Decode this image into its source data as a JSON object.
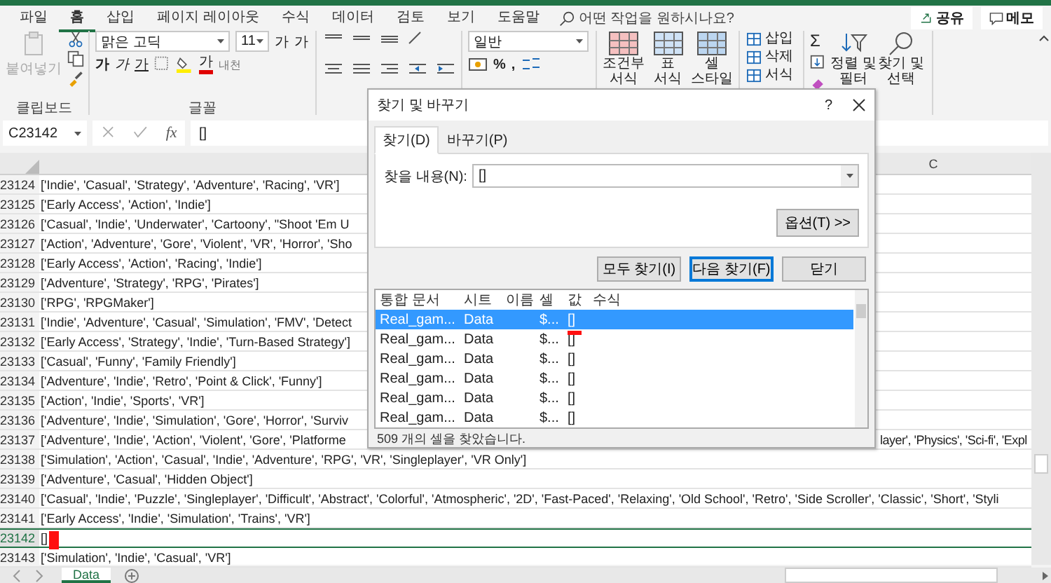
{
  "menu": {
    "tabs": [
      {
        "label": "파일",
        "selected": false
      },
      {
        "label": "홈",
        "selected": true
      },
      {
        "label": "삽입",
        "selected": false
      },
      {
        "label": "페이지 레이아웃",
        "selected": false
      },
      {
        "label": "수식",
        "selected": false
      },
      {
        "label": "데이터",
        "selected": false
      },
      {
        "label": "검토",
        "selected": false
      },
      {
        "label": "보기",
        "selected": false
      },
      {
        "label": "도움말",
        "selected": false
      }
    ],
    "search_placeholder": "어떤 작업을 원하시나요?",
    "share": "공유",
    "comments": "메모"
  },
  "ribbon": {
    "paste": {
      "label": "붙여넣기",
      "disabled": true
    },
    "clipboard_group": "클립보드",
    "font": {
      "name": "맑은 고딕",
      "size": "11",
      "grow": "가",
      "shrink": "가",
      "bold": "가",
      "italic": "가",
      "underline": "가",
      "font_color": "가",
      "phonetic": "내천",
      "group": "글꼴"
    },
    "number": {
      "format": "일반",
      "percent": "%",
      "comma": ","
    },
    "styles": [
      {
        "lines": [
          "조건부",
          "서식"
        ]
      },
      {
        "lines": [
          "표",
          "서식"
        ]
      },
      {
        "lines": [
          "셀",
          "스타일"
        ]
      }
    ],
    "cells": [
      "삽입",
      "삭제",
      "서식"
    ],
    "editing": {
      "autosum": "Σ",
      "sort": [
        "정렬 및",
        "필터"
      ],
      "find": [
        "찾기 및",
        "선택"
      ]
    }
  },
  "formula_bar": {
    "name_box": "C23142",
    "fx": "fx",
    "value": "[]"
  },
  "sheet": {
    "column_header": "C",
    "rows": [
      {
        "number": "23124",
        "text": "['Indie', 'Casual', 'Strategy', 'Adventure', 'Racing', 'VR']",
        "selected": false
      },
      {
        "number": "23125",
        "text": "['Early Access', 'Action', 'Indie']",
        "selected": false
      },
      {
        "number": "23126",
        "text": "['Casual', 'Indie', 'Underwater', 'Cartoony', \"Shoot 'Em U",
        "selected": false
      },
      {
        "number": "23127",
        "text": "['Action', 'Adventure', 'Gore', 'Violent', 'VR', 'Horror', 'Sho",
        "selected": false
      },
      {
        "number": "23128",
        "text": "['Early Access', 'Action', 'Racing', 'Indie']",
        "selected": false
      },
      {
        "number": "23129",
        "text": "['Adventure', 'Strategy', 'RPG', 'Pirates']",
        "selected": false
      },
      {
        "number": "23130",
        "text": "['RPG', 'RPGMaker']",
        "selected": false
      },
      {
        "number": "23131",
        "text": "['Indie', 'Adventure', 'Casual', 'Simulation', 'FMV', 'Detect",
        "selected": false
      },
      {
        "number": "23132",
        "text": "['Early Access', 'Strategy', 'Indie', 'Turn-Based Strategy']",
        "selected": false
      },
      {
        "number": "23133",
        "text": "['Casual', 'Funny', 'Family Friendly']",
        "selected": false
      },
      {
        "number": "23134",
        "text": "['Adventure', 'Indie', 'Retro', 'Point & Click', 'Funny']",
        "selected": false
      },
      {
        "number": "23135",
        "text": "['Action', 'Indie', 'Sports', 'VR']",
        "selected": false
      },
      {
        "number": "23136",
        "text": "['Adventure', 'Indie', 'Simulation', 'Gore', 'Horror', 'Surviv",
        "selected": false
      },
      {
        "number": "23137",
        "text": "['Adventure', 'Indie', 'Action', 'Violent', 'Gore', 'Platforme",
        "text_right": "layer', 'Physics', 'Sci-fi', 'Expl",
        "selected": false
      },
      {
        "number": "23138",
        "text": "['Simulation', 'Action', 'Casual', 'Indie', 'Adventure', 'RPG', 'VR', 'Singleplayer', 'VR Only']",
        "selected": false
      },
      {
        "number": "23139",
        "text": "['Adventure', 'Casual', 'Hidden Object']",
        "selected": false
      },
      {
        "number": "23140",
        "text": "['Casual', 'Indie', 'Puzzle', 'Singleplayer', 'Difficult', 'Abstract', 'Colorful', 'Atmospheric', '2D', 'Fast-Paced', 'Relaxing', 'Old School', 'Retro', 'Side Scroller', 'Classic', 'Short', 'Styli",
        "selected": false
      },
      {
        "number": "23141",
        "text": "['Early Access', 'Indie', 'Simulation', 'Trains', 'VR']",
        "selected": false
      },
      {
        "number": "23142",
        "text": "[]",
        "selected": true
      },
      {
        "number": "23143",
        "text": "['Simulation', 'Indie', 'Casual', 'VR']",
        "selected": false
      }
    ]
  },
  "dialog": {
    "title": "찾기 및 바꾸기",
    "help": "?",
    "tabs": [
      {
        "label": "찾기(D)",
        "selected": true
      },
      {
        "label": "바꾸기(P)",
        "selected": false
      }
    ],
    "find_label": "찾을 내용(N):",
    "find_value": "[]",
    "options_button": "옵션(T) >>",
    "buttons": [
      {
        "label": "모두 찾기(I)",
        "focused": false
      },
      {
        "label": "다음 찾기(F)",
        "focused": true
      },
      {
        "label": "닫기",
        "focused": false
      }
    ],
    "results": {
      "columns": [
        "통합 문서",
        "시트",
        "이름",
        "셀",
        "값",
        "수식"
      ],
      "rows": [
        {
          "workbook": "Real_gam...",
          "sheet": "Data",
          "cell": "$...",
          "value": "[]",
          "selected": true
        },
        {
          "workbook": "Real_gam...",
          "sheet": "Data",
          "cell": "$...",
          "value": "[]",
          "selected": false
        },
        {
          "workbook": "Real_gam...",
          "sheet": "Data",
          "cell": "$...",
          "value": "[]",
          "selected": false
        },
        {
          "workbook": "Real_gam...",
          "sheet": "Data",
          "cell": "$...",
          "value": "[]",
          "selected": false
        },
        {
          "workbook": "Real_gam...",
          "sheet": "Data",
          "cell": "$...",
          "value": "[]",
          "selected": false
        },
        {
          "workbook": "Real_gam...",
          "sheet": "Data",
          "cell": "$...",
          "value": "[]",
          "selected": false
        }
      ]
    },
    "status": "509 개의 셀을 찾았습니다."
  },
  "sheet_tabs": [
    {
      "label": "Data",
      "selected": true
    }
  ]
}
